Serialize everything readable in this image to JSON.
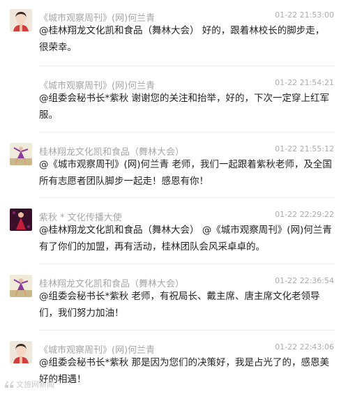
{
  "comments": [
    {
      "name": "《城市观察周刊》(网)何兰青",
      "time": "01-22 21:53:00",
      "text": "@桂林翔龙文化凯和食品（舞林大会） 好的，跟着林校长的脚步走，很荣幸。",
      "avatar": "woman-portrait"
    },
    {
      "name": "《城市观察周刊》(网)何兰青",
      "time": "01-22 21:54:21",
      "text": "@组委会秘书长*紫秋 谢谢您的关注和抬举，好的，下次一定穿上红军服。",
      "avatar": "none"
    },
    {
      "name": "桂林翔龙文化凯和食品（舞林大会）",
      "time": "01-22 21:55:12",
      "text": "@《城市观察周刊》(网)何兰青 老师，我们一起跟着紫秋老师，及全国所有志愿者团队脚步一起走！感恩有你！",
      "avatar": "dancer-purple"
    },
    {
      "name": "紫秋 * 文化传播大使",
      "time": "01-22 22:29:22",
      "text": "@桂林翔龙文化凯和食品（舞林大会） @《城市观察周刊》(网)何兰青 有了你们的加盟，再有活动，桂林团队会风采卓卓的。",
      "avatar": "performer-red"
    },
    {
      "name": "桂林翔龙文化凯和食品（舞林大会）",
      "time": "01-22 22:36:54",
      "text": "@组委会秘书长*紫秋 老师，有祝局长、戴主席、唐主席文化老领导们，我们努力加油！",
      "avatar": "dancer-purple"
    },
    {
      "name": "《城市观察周刊》(网)何兰青",
      "time": "01-22 22:43:06",
      "text": "@组委会秘书长*紫秋 那是因为您们的决策好，我是占光了的，感恩美好的相遇！",
      "avatar": "woman-portrait"
    }
  ],
  "watermark": "文旅网新闻"
}
